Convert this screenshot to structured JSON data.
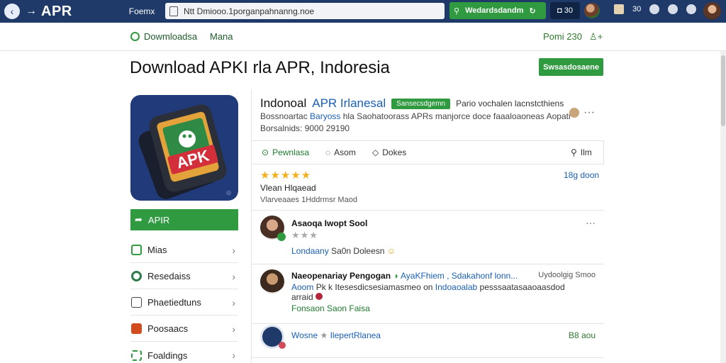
{
  "topbar": {
    "brand": "APR",
    "menu": "Foemx",
    "url": "Ntt Dmiooo.1porganpahnanng.noe",
    "search_label": "Wedardsdandm",
    "cam_label": "30",
    "icon_label": "30"
  },
  "subbar": {
    "downloads": "Dowmloadsa",
    "mana": "Mana",
    "right_label": "Pomi 230"
  },
  "page": {
    "title": "Download APKI rla APR, Indoresia",
    "primary_button": "Swsasdosaene"
  },
  "sidebar": {
    "active": "APIR",
    "items": [
      {
        "label": "Mias",
        "icon": "check-square-icon",
        "color": "#2f9a3f"
      },
      {
        "label": "Resedaiss",
        "icon": "circle-icon",
        "color": "#2f7a4a"
      },
      {
        "label": "Phaetiedtuns",
        "icon": "edit-icon",
        "color": "#444444"
      },
      {
        "label": "Poosaacs",
        "icon": "gamepad-icon",
        "color": "#d14b1f"
      },
      {
        "label": "Foaldings",
        "icon": "puzzle-icon",
        "color": "#2f9a3f"
      }
    ]
  },
  "app": {
    "name_a": "Indonoal",
    "name_b": "APR Irlanesal",
    "badge": "Sansecsdgemn",
    "extra": "Pario vochalen lacnstcthiens",
    "desc1_a": "Bossnoartac",
    "desc1_b": "Baryoss",
    "desc1_c": "hla Saohatoorass APRs manjorce doce faaaloaoneas Aopati",
    "desc2": "Borsalnids: 9000 29190",
    "icon_text": "APK",
    "icon_accent": "#d32f3b"
  },
  "tabs": {
    "t1": "Pewnlasa",
    "t2": "Asom",
    "t3": "Dokes",
    "t4": "Ilm"
  },
  "rating": {
    "stars": "★★★★★",
    "count": "18g doon",
    "info_a": "Vlean Hlqaead",
    "info_b": "Vlarveaaes 1Hddrmsr Maod"
  },
  "reviews": [
    {
      "name": "Asaoqa Iwopt Sool",
      "stars": "★★★",
      "text_a": "Londaany",
      "text_b": "Sa0n Doleesn",
      "meta": "···"
    },
    {
      "name": "Naeopenariay Pengogan",
      "mid": "AyaKFhiem , Sdakahonf lonn...",
      "meta": "Uydoolgig Smoo",
      "text_a": "Aoom",
      "text_b": "Pk k Itesesdicsesiamasmeo on",
      "text_c": "Indoaoalab",
      "text_d": "pesssaatasaaoaasdod",
      "text_e": "arraid",
      "text_f": "Fonsaon Saon Faisa"
    },
    {
      "name": "Wosne",
      "text_b": "IlepertRlanea",
      "meta": "B8 aou"
    }
  ]
}
